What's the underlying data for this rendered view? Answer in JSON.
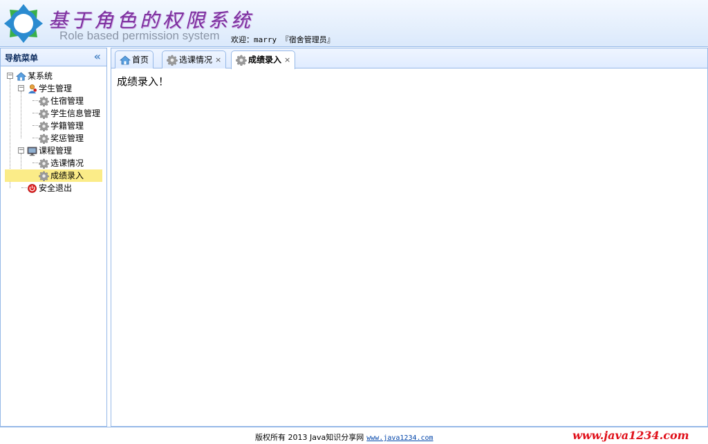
{
  "header": {
    "title_cn": "基于角色的权限系统",
    "title_en": "Role based permission system",
    "welcome": "欢迎：marry 『宿舍管理员』"
  },
  "sidebar": {
    "title": "导航菜单",
    "collapse_icon": "double-chevron-left-icon",
    "tree": {
      "root": "某系统",
      "student_group": "学生管理",
      "student_items": [
        "住宿管理",
        "学生信息管理",
        "学籍管理",
        "奖惩管理"
      ],
      "course_group": "课程管理",
      "course_items": [
        "选课情况",
        "成绩录入"
      ],
      "logout": "安全退出"
    }
  },
  "tabs": [
    {
      "label": "首页",
      "icon": "home-icon",
      "closable": false
    },
    {
      "label": "选课情况",
      "icon": "gear-icon",
      "closable": true
    },
    {
      "label": "成绩录入",
      "icon": "gear-icon",
      "closable": true,
      "active": true
    }
  ],
  "tab_close_symbol": "×",
  "content": {
    "text": "成绩录入！"
  },
  "footer": {
    "copyright": "版权所有 2013 Java知识分享网",
    "link": "www.java1234.com",
    "watermark": "www.java1234.com"
  },
  "colors": {
    "border": "#95b8e7",
    "selected": "#fbec88",
    "title": "#7c2f9e",
    "watermark": "#e0101a"
  }
}
